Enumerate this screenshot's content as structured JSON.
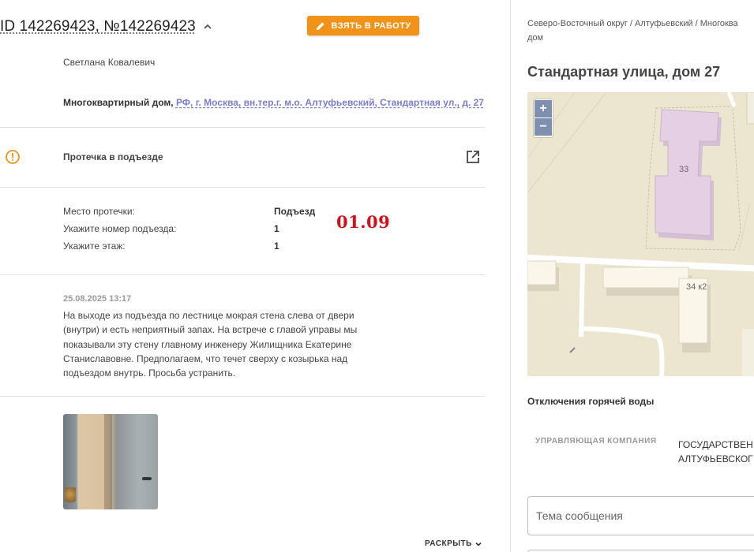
{
  "ticket": {
    "id_label": "ID 142269423, №142269423",
    "take_button": "ВЗЯТЬ В РАБОТУ",
    "person": "Светлана Ковалевич",
    "address_type": "Многоквартирный дом,",
    "address_link": "РФ, г. Москва, вн.тер.г. м.о. Алтуфьевский, Стандартная ул., д. 27",
    "issue_title": "Протечка в подъезде",
    "fields": [
      {
        "label": "Место протечки:",
        "value": "Подъезд"
      },
      {
        "label": "Укажите номер подъезда:",
        "value": "1"
      },
      {
        "label": "Укажите этаж:",
        "value": "1"
      }
    ],
    "stamp": "01.09",
    "comment": {
      "date": "25.08.2025 13:17",
      "text": "На выходе из подъезда по лестнице мокрая стена слева от двери (внутри) и есть неприятный запах. На встрече с главой управы мы показывали эту стену главному инженеру Жилищника Екатерине Станиславовне. Предполагаем, что течет сверху с козырька над подъездом внутрь. Просьба устранить."
    },
    "expand_label": "РАСКРЫТЬ"
  },
  "colors": {
    "accent_orange": "#f29319",
    "link_purple": "#7b7ccf",
    "stamp_red": "#d2111b",
    "map_building": "#e5cfe4"
  },
  "sidebar": {
    "breadcrumb_line1": "Северо-Восточный округ / Алтуфьевский / Многоква",
    "breadcrumb_line2": "дом",
    "street_title": "Стандартная улица, дом 27",
    "map": {
      "zoom_in": "+",
      "zoom_out": "−",
      "building_33": "33",
      "building_34k2": "34 к2"
    },
    "hot_water_title": "Отключения горячей воды",
    "mc_label": "УПРАВЛЯЮЩАЯ КОМПАНИЯ",
    "mc_value_line1": "ГОСУДАРСТВЕН",
    "mc_value_line2": "АЛТУФЬЕВСКОГ",
    "message_placeholder": "Тема сообщения"
  },
  "icons": {
    "chevron": "chevron-up-icon",
    "pencil": "pencil-icon",
    "warning": "warning-circle-icon",
    "external": "open-external-icon",
    "expand": "chevron-down-icon"
  }
}
